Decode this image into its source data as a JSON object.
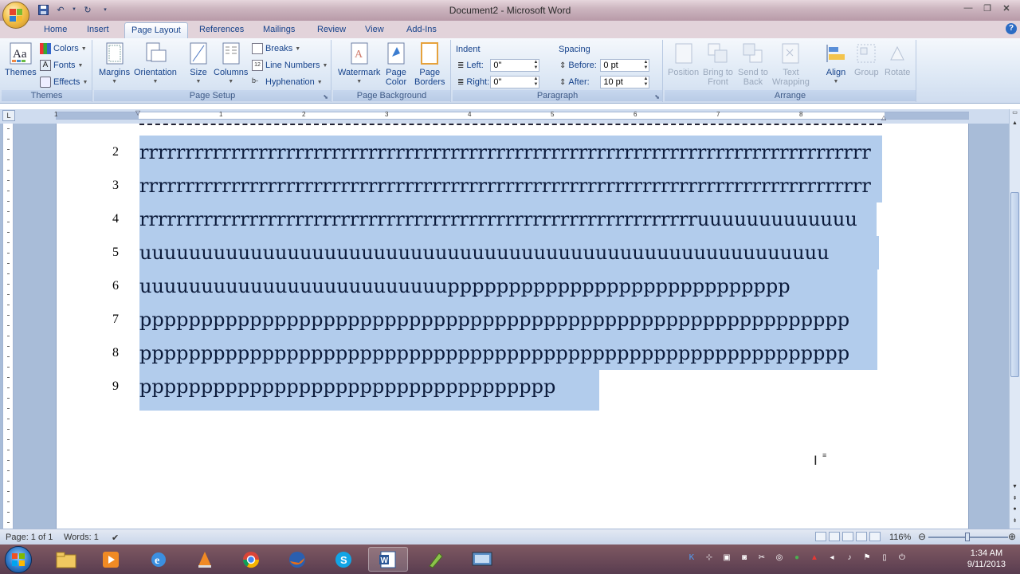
{
  "window": {
    "title": "Document2 - Microsoft Word"
  },
  "tabs": [
    {
      "label": "Home",
      "active": false
    },
    {
      "label": "Insert",
      "active": false
    },
    {
      "label": "Page Layout",
      "active": true
    },
    {
      "label": "References",
      "active": false
    },
    {
      "label": "Mailings",
      "active": false
    },
    {
      "label": "Review",
      "active": false
    },
    {
      "label": "View",
      "active": false
    },
    {
      "label": "Add-Ins",
      "active": false
    }
  ],
  "ribbon": {
    "themes": {
      "label": "Themes",
      "themes_btn": "Themes",
      "colors": "Colors",
      "fonts": "Fonts",
      "effects": "Effects"
    },
    "page_setup": {
      "label": "Page Setup",
      "margins": "Margins",
      "orientation": "Orientation",
      "size": "Size",
      "columns": "Columns",
      "breaks": "Breaks",
      "line_numbers": "Line Numbers",
      "hyphenation": "Hyphenation"
    },
    "page_background": {
      "label": "Page Background",
      "watermark": "Watermark",
      "page_color_1": "Page",
      "page_color_2": "Color",
      "page_borders_1": "Page",
      "page_borders_2": "Borders"
    },
    "paragraph": {
      "label": "Paragraph",
      "indent": "Indent",
      "left_label": "Left:",
      "left_value": "0\"",
      "right_label": "Right:",
      "right_value": "0\"",
      "spacing": "Spacing",
      "before_label": "Before:",
      "before_value": "0 pt",
      "after_label": "After:",
      "after_value": "10 pt"
    },
    "arrange": {
      "label": "Arrange",
      "position": "Position",
      "bring_front_1": "Bring to",
      "bring_front_2": "Front",
      "send_back_1": "Send to",
      "send_back_2": "Back",
      "text_wrap_1": "Text",
      "text_wrap_2": "Wrapping",
      "align": "Align",
      "group": "Group",
      "rotate": "Rotate"
    }
  },
  "ruler": {
    "numbers": [
      "1",
      "1",
      "2",
      "3",
      "4",
      "5",
      "6",
      "7",
      "8"
    ]
  },
  "document": {
    "lines": [
      {
        "num": "2",
        "text": "rrrrrrrrrrrrrrrrrrrrrrrrrrrrrrrrrrrrrrrrrrrrrrrrrrrrrrrrrrrrrrrrrrrrrrrrrrrrrrrr"
      },
      {
        "num": "3",
        "text": "rrrrrrrrrrrrrrrrrrrrrrrrrrrrrrrrrrrrrrrrrrrrrrrrrrrrrrrrrrrrrrrrrrrrrrrrrrrrrrrr"
      },
      {
        "num": "4",
        "text": "rrrrrrrrrrrrrrrrrrrrrrrrrrrrrrrrrrrrrrrrrrrrrrrrrrrrrrrrrrrrruuuuuuuuuuuuu"
      },
      {
        "num": "5",
        "text": "uuuuuuuuuuuuuuuuuuuuuuuuuuuuuuuuuuuuuuuuuuuuuuuuuuuuuuuu"
      },
      {
        "num": "6",
        "text": "uuuuuuuuuuuuuuuuuuuuuuuuupppppppppppppppppppppppppppp"
      },
      {
        "num": "7",
        "text": "pppppppppppppppppppppppppppppppppppppppppppppppppppppppppp"
      },
      {
        "num": "8",
        "text": "pppppppppppppppppppppppppppppppppppppppppppppppppppppppppp"
      },
      {
        "num": "9",
        "text": "pppppppppppppppppppppppppppppppppp"
      }
    ]
  },
  "status": {
    "page": "Page: 1 of 1",
    "words": "Words: 1",
    "zoom": "116%"
  },
  "taskbar": {
    "time": "1:34 AM",
    "date": "9/11/2013"
  }
}
